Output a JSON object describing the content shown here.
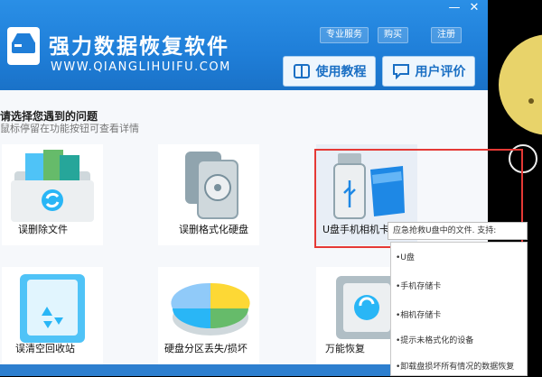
{
  "app": {
    "title": "强力数据恢复软件",
    "url": "WWW.QIANGLIHUIFU.COM",
    "top_menu": [
      "专业服务",
      "购买",
      "注册"
    ],
    "window_controls": [
      "—",
      "✕"
    ],
    "buttons": {
      "tutorial": "使用教程",
      "review": "用户评价"
    }
  },
  "content": {
    "heading": "请选择您遇到的问题",
    "subheading": "鼠标停留在功能按钮可查看详情",
    "cards": [
      {
        "label": "误删除文件",
        "icon": "deleted-files-icon"
      },
      {
        "label": "误删格式化硬盘",
        "icon": "format-disk-icon"
      },
      {
        "label": "U盘手机相机卡",
        "icon": "usb-sd-card-icon"
      },
      {
        "label": "误清空回收站",
        "icon": "recycle-bin-icon"
      },
      {
        "label": "硬盘分区丢失/损坏",
        "icon": "partition-pie-icon"
      },
      {
        "label": "万能恢复",
        "icon": "safe-recover-icon"
      }
    ]
  },
  "tooltip": {
    "title": "应急抢救U盘中的文件. 支持:",
    "items": [
      "•U盘",
      "•手机存储卡",
      "•相机存储卡",
      "•提示未格式化的设备",
      "•卸载盘损坏所有情况的数据恢复"
    ]
  },
  "colors": {
    "accent": "#1f7ed8",
    "highlight": "#e53935"
  }
}
